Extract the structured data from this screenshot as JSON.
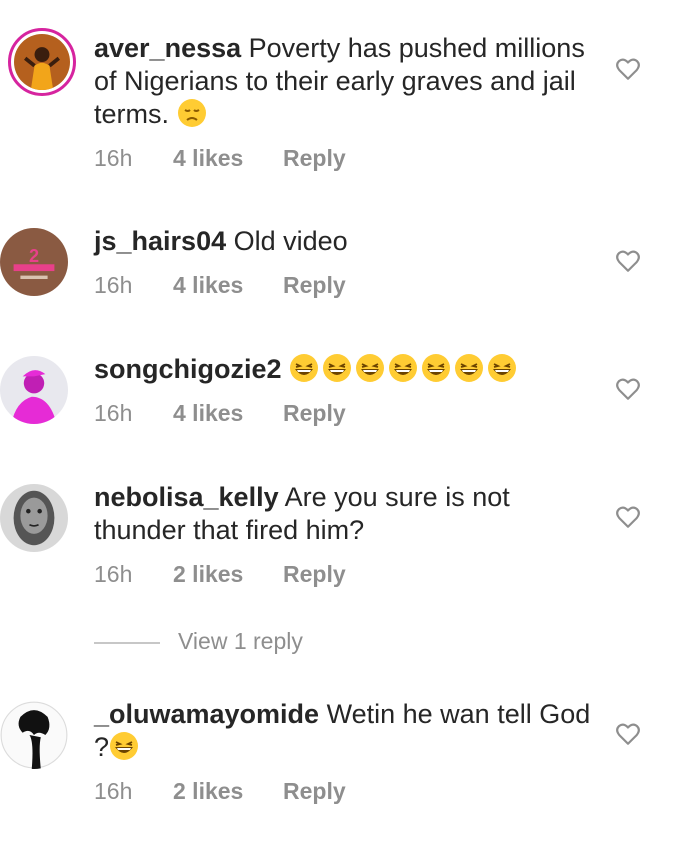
{
  "comments": [
    {
      "username": "aver_nessa",
      "text": "Poverty has pushed millions of Nigerians to their early graves and jail terms.",
      "emoji": [
        "sad-face"
      ],
      "time": "16h",
      "likes": "4 likes",
      "reply": "Reply"
    },
    {
      "username": "js_hairs04",
      "text": "Old video",
      "emoji": [],
      "time": "16h",
      "likes": "4 likes",
      "reply": "Reply"
    },
    {
      "username": "songchigozie2",
      "text": "",
      "emoji": [
        "laughing-face",
        "laughing-face",
        "laughing-face",
        "laughing-face",
        "laughing-face",
        "laughing-face",
        "laughing-face"
      ],
      "time": "16h",
      "likes": "4 likes",
      "reply": "Reply"
    },
    {
      "username": "nebolisa_kelly",
      "text": "Are you sure is not thunder that fired him?",
      "emoji": [],
      "time": "16h",
      "likes": "2 likes",
      "reply": "Reply",
      "view_replies": "View 1 reply"
    },
    {
      "username": "_oluwamayomide",
      "text": "Wetin he wan tell God ?",
      "emoji": [
        "laughing-face"
      ],
      "time": "16h",
      "likes": "2 likes",
      "reply": "Reply"
    }
  ],
  "colors": {
    "text": "#262626",
    "meta": "#8e8e8e",
    "story_ring": "#d6249f",
    "emoji_yellow": "#ffcc33"
  },
  "icons": {
    "like": "heart-outline-icon"
  }
}
